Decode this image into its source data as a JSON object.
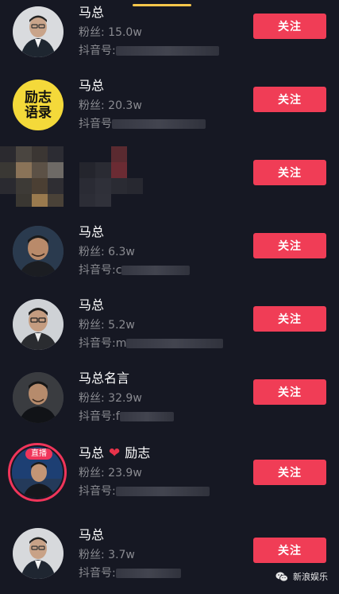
{
  "follow_label": "关注",
  "accounts": [
    {
      "name": "马总",
      "fans": "粉丝: 15.0w",
      "douyin_id": "抖音号:"
    },
    {
      "name": "马总",
      "fans": "粉丝: 20.3w",
      "douyin_id": "抖音号",
      "avatar_text_1": "励志",
      "avatar_text_2": "语录"
    },
    {
      "name": "",
      "fans": "",
      "douyin_id": ""
    },
    {
      "name": "马总",
      "fans": "粉丝: 6.3w",
      "douyin_id": "抖音号:c"
    },
    {
      "name": "马总",
      "fans": "粉丝: 5.2w",
      "douyin_id": "抖音号:m"
    },
    {
      "name": "马总名言",
      "fans": "粉丝: 32.9w",
      "douyin_id": "抖音号:f"
    },
    {
      "name": "马总",
      "name_suffix": "励志",
      "fans": "粉丝: 23.9w",
      "douyin_id": "抖音号:",
      "live_badge": "直播"
    },
    {
      "name": "马总",
      "fans": "粉丝: 3.7w",
      "douyin_id": "抖音号:"
    }
  ],
  "watermark": {
    "text": "新浪娱乐",
    "icon": "wechat-icon"
  },
  "colors": {
    "background": "#161823",
    "follow_button": "#f03d56",
    "live_ring": "#f0355a",
    "tab_indicator": "#f7c64b"
  }
}
